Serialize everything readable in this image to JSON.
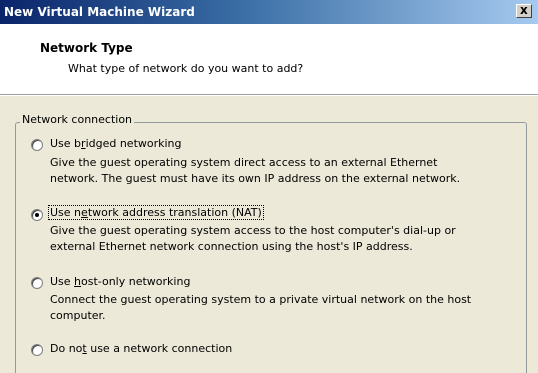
{
  "window": {
    "title": "New Virtual Machine Wizard",
    "close_label": "x"
  },
  "header": {
    "title": "Network Type",
    "subtitle": "What type of network do you want to add?"
  },
  "group": {
    "legend": "Network connection"
  },
  "options": [
    {
      "label_pre": "Use b",
      "label_accel": "r",
      "label_post": "idged networking",
      "checked": false,
      "desc1": "Give the guest operating system direct access to an external Ethernet",
      "desc2": "network. The guest must have its own IP address on the external network."
    },
    {
      "label_pre": "Use n",
      "label_accel": "e",
      "label_post": "twork address translation (NAT)",
      "checked": true,
      "desc1": "Give the guest operating system access to the host computer's dial-up or",
      "desc2": "external Ethernet network connection using the host's IP address."
    },
    {
      "label_pre": "Use ",
      "label_accel": "h",
      "label_post": "ost-only networking",
      "checked": false,
      "desc1": "Connect the guest operating system to a private virtual network on the host",
      "desc2": "computer."
    },
    {
      "label_pre": "Do no",
      "label_accel": "t",
      "label_post": " use a network connection",
      "checked": false
    }
  ]
}
